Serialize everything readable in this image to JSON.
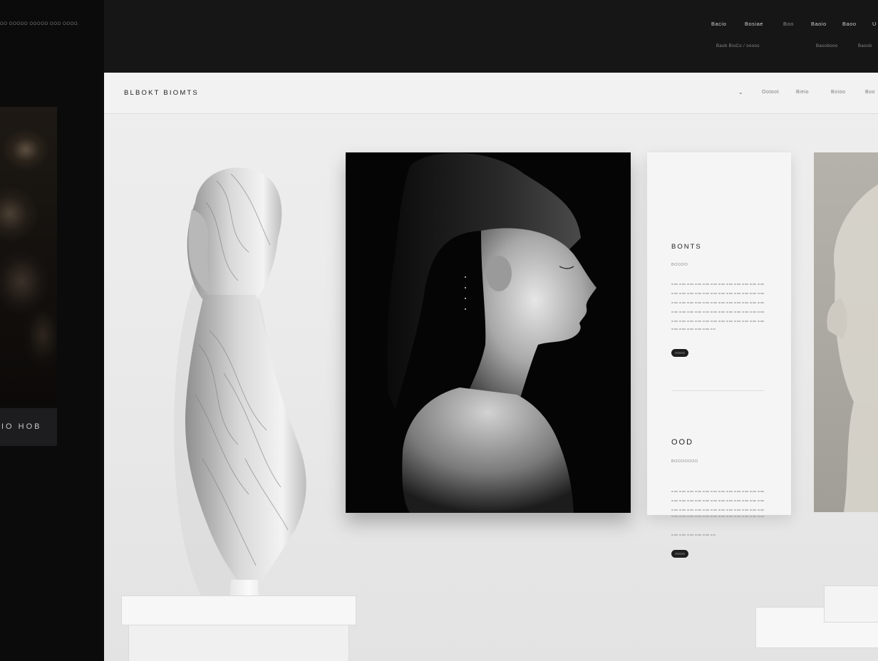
{
  "left_panel": {
    "tagline": "OO OOOOO OOOOO OOO OOOO.",
    "caption": "IO HOB"
  },
  "top_nav": {
    "links": [
      "Bacio",
      "Bosiae",
      "Boo",
      "Baoio",
      "Baoo",
      "U"
    ],
    "active_index": 2,
    "sub_links": [
      "Baob BioCo / ooooo",
      "Baoobooo",
      "Baoob"
    ]
  },
  "page": {
    "brand": "BLBOKT BIOMTS",
    "chevron_icon": "chevron-down-icon",
    "nav_links": [
      "Ootoot",
      "Bieio",
      "Boioo",
      "Boo"
    ]
  },
  "card": {
    "section1": {
      "title": "BONTS",
      "subtitle": "BOOOO",
      "button": "OOOO"
    },
    "section2": {
      "title": "OOD",
      "subtitle": "BOOOOOOO",
      "button": "OOOO"
    }
  },
  "colors": {
    "dark_bg": "#0b0b0c",
    "topbar_bg": "#161617",
    "page_bg": "#ebebeb",
    "card_bg": "#f5f5f5",
    "pill": "#1e1e1e"
  }
}
